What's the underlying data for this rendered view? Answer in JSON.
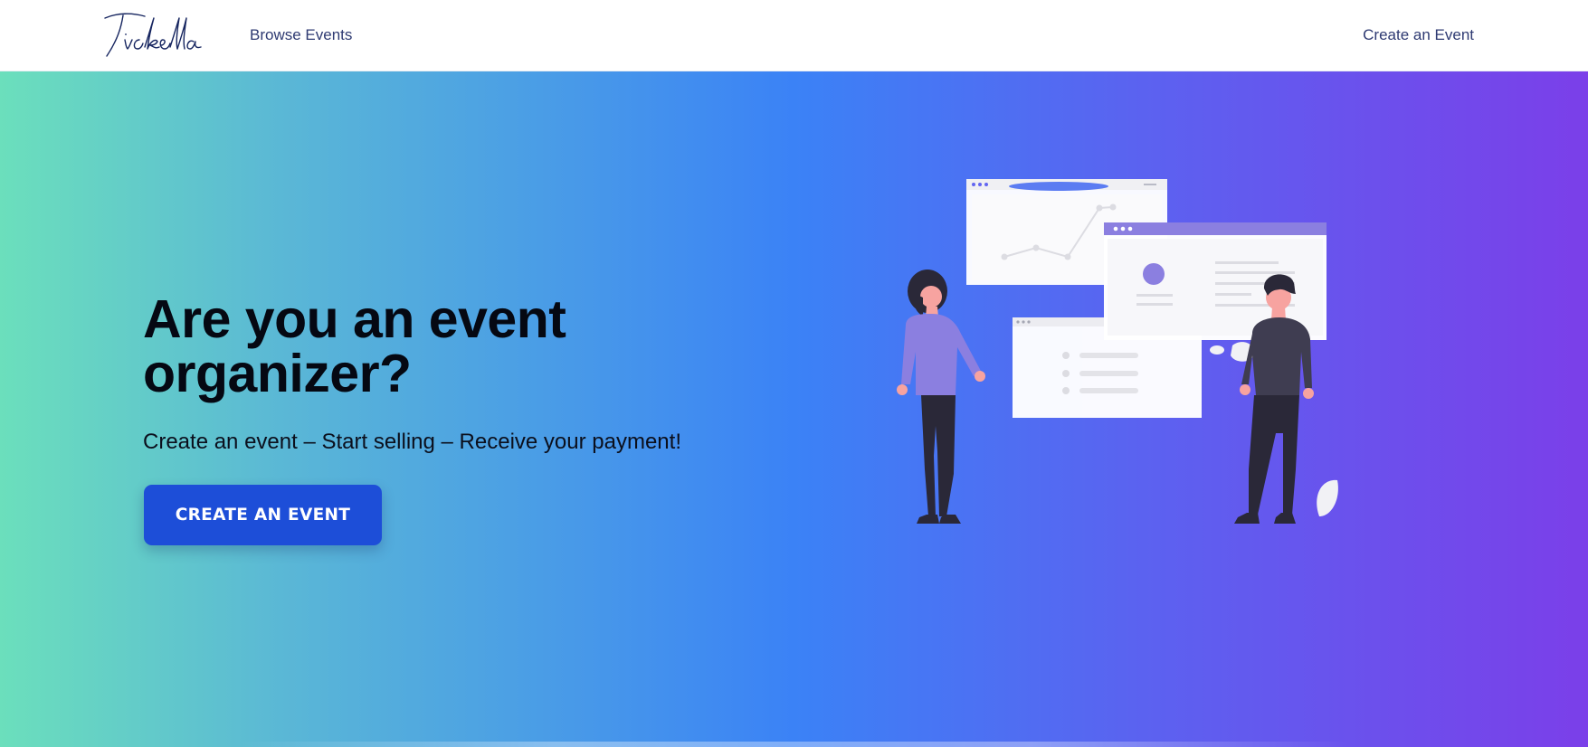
{
  "header": {
    "logo_text": "Tickella",
    "nav": {
      "browse_events": "Browse Events",
      "create_event": "Create an Event"
    }
  },
  "hero": {
    "title": "Are you an event organizer?",
    "subtitle": "Create an event – Start selling – Receive your payment!",
    "cta_label": "CREATE AN EVENT",
    "illustration_icon": "organizers-illustration"
  },
  "colors": {
    "cta": "#1d4ed8",
    "nav_text": "#2e3a72",
    "gradient_start": "#6bdfbc",
    "gradient_mid": "#3b82f6",
    "gradient_end": "#7b3fe9",
    "illustration_accent": "#8b7fe0"
  }
}
